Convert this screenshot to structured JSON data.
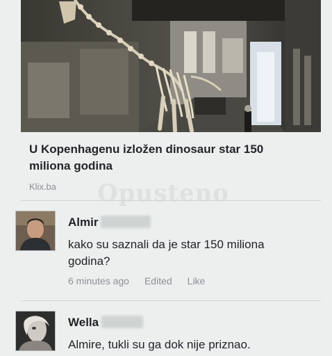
{
  "post": {
    "title": "U Kopenhagenu izložen dinosaur star 150 miliona godina",
    "source": "Klix.ba",
    "watermark": "Opusteno"
  },
  "comments": [
    {
      "name": "Almir",
      "text": "kako su saznali da je star 150 miliona godina?",
      "time": "6 minutes ago",
      "edited": "Edited",
      "like": "Like"
    },
    {
      "name": "Wella",
      "text": "Almire, tukli su ga dok nije priznao."
    }
  ],
  "colors": {
    "background": "#ecefed",
    "text": "#1f2326",
    "meta": "#8c9196"
  }
}
